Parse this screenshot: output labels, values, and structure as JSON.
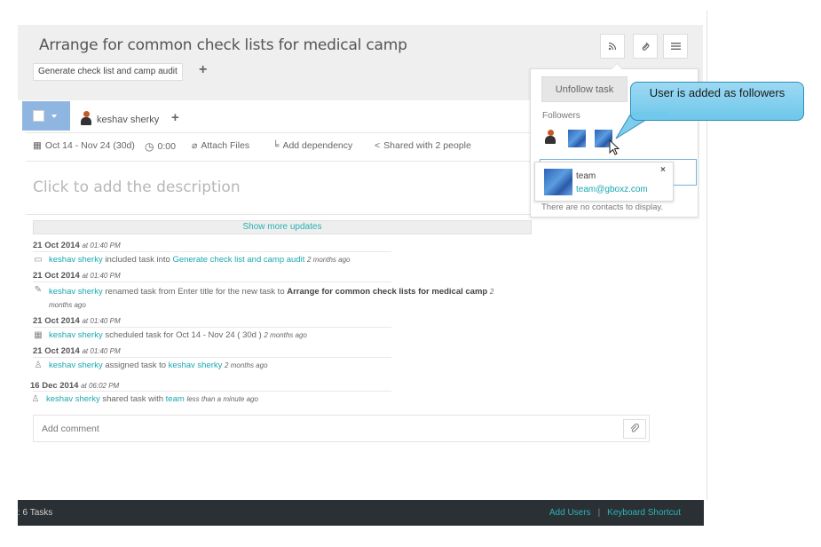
{
  "task": {
    "title": "Arrange for common check lists for medical camp",
    "tag": "Generate check list and camp audit",
    "assignee": "keshav sherky",
    "description_placeholder": "Click to add the description"
  },
  "meta": {
    "dates": "Oct 14 - Nov 24 (30d)",
    "time": "0:00",
    "attach": "Attach Files",
    "dependency": "Add dependency",
    "shared": "Shared with 2 people"
  },
  "activity": {
    "show_more": "Show more updates",
    "entries": [
      {
        "date": "21 Oct 2014",
        "time": "at 01:40 PM",
        "user": "keshav sherky",
        "text": "included task into",
        "target": "Generate check list and camp audit",
        "ago": "2 months ago"
      },
      {
        "date": "21 Oct 2014",
        "time": "at 01:40 PM",
        "user": "keshav sherky",
        "text": "renamed task from Enter title for the new task to",
        "target": "Arrange for common check lists for medical camp",
        "ago": "2 months ago"
      },
      {
        "date": "21 Oct 2014",
        "time": "at 01:40 PM",
        "user": "keshav sherky",
        "text": "scheduled task for Oct 14 - Nov 24 ( 30d )",
        "ago": "2 months ago"
      },
      {
        "date": "21 Oct 2014",
        "time": "at 01:40 PM",
        "user": "keshav sherky",
        "text": "assigned task to",
        "target": "keshav sherky",
        "ago": "2 months ago"
      },
      {
        "date": "16 Dec 2014",
        "time": "at 06:02 PM",
        "user": "keshav sherky",
        "text": "shared task with",
        "target": "team",
        "ago": "less than a minute ago"
      }
    ]
  },
  "comment": {
    "placeholder": "Add comment"
  },
  "popover": {
    "unfollow": "Unfollow task",
    "followers_label": "Followers",
    "no_contacts": "There are no contacts to display.",
    "contact": {
      "name": "team",
      "email": "team@gboxz.com",
      "close": "×"
    }
  },
  "callout": {
    "text": "User is added as followers"
  },
  "footer": {
    "tasks": ": 6 Tasks",
    "add_users": "Add Users",
    "separator": "|",
    "keyboard_shortcut": "Keyboard Shortcut"
  },
  "icons": {
    "rss": "rss-icon",
    "link": "link-icon",
    "menu": "menu-icon",
    "calendar": "calendar-icon",
    "clock": "clock-icon",
    "paperclip": "paperclip-icon",
    "dependency": "dependency-icon",
    "share": "share-icon"
  },
  "colors": {
    "accent": "#1aa8b0",
    "check_button": "#8fb6e0",
    "footer_bg": "#2b3035",
    "callout": "#6ec7ea"
  }
}
